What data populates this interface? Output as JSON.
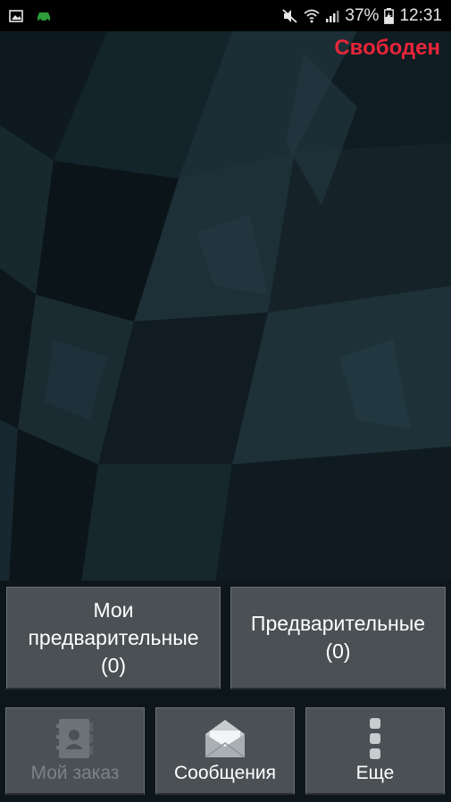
{
  "status_bar": {
    "battery_percent": "37%",
    "time": "12:31",
    "icons": [
      "image-icon",
      "car-icon",
      "mute-icon",
      "wifi-icon",
      "signal-icon",
      "battery-charging-icon"
    ]
  },
  "app": {
    "driver_status": "Свободен",
    "driver_status_color": "#e8253a"
  },
  "orders": {
    "my_preliminary": {
      "line1": "Мои",
      "line2": "предварительные",
      "count": "(0)"
    },
    "preliminary": {
      "line1": "Предварительные",
      "count": "(0)"
    }
  },
  "bottom_nav": {
    "my_order": {
      "label": "Мой заказ",
      "icon": "contacts-book-icon",
      "enabled": false
    },
    "messages": {
      "label": "Сообщения",
      "icon": "envelope-icon",
      "enabled": true
    },
    "more": {
      "label": "Еще",
      "icon": "more-dots-icon",
      "enabled": true
    }
  }
}
